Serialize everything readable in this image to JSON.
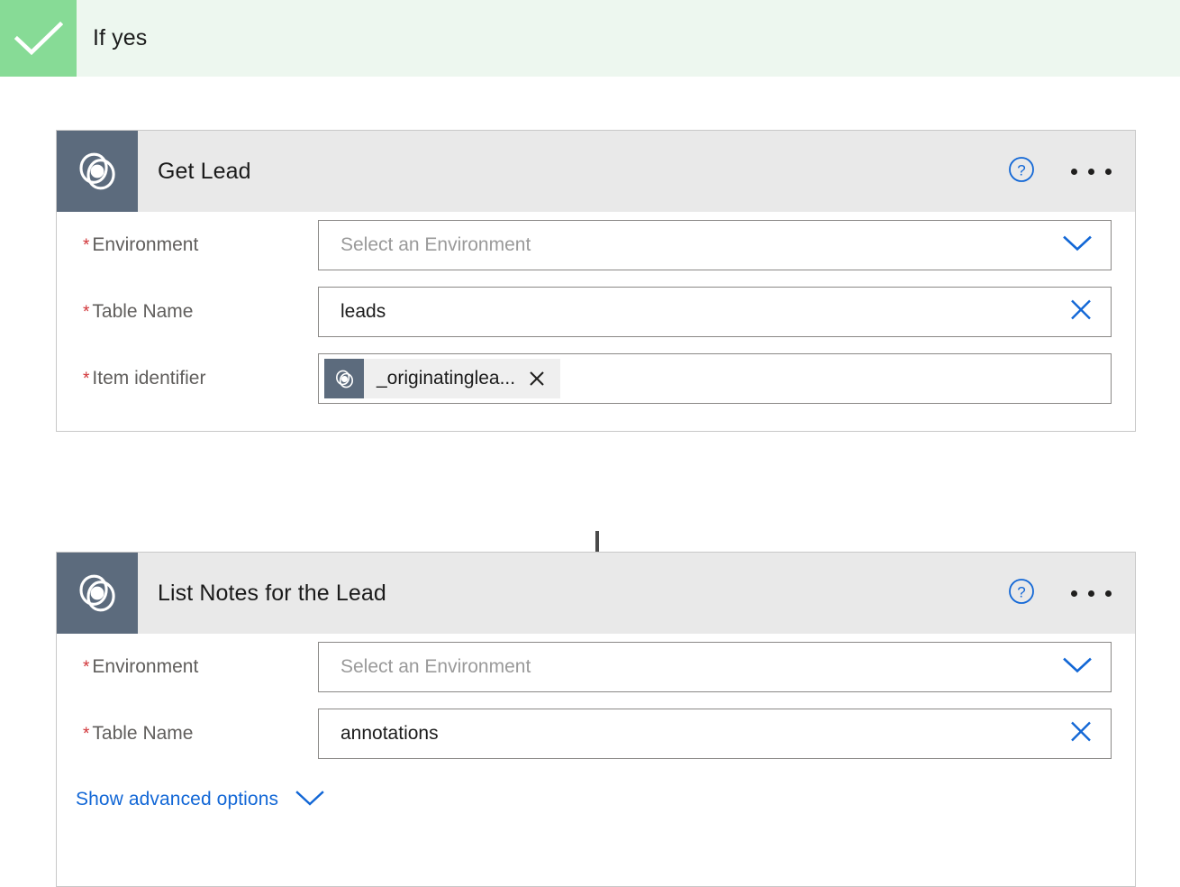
{
  "branch": {
    "title": "If yes",
    "icon": "checkmark-icon",
    "badge_color": "#87DB96",
    "band_color": "#EDF7EF"
  },
  "colors": {
    "accent_blue": "#1267d6",
    "icon_tile": "#5C6B7D",
    "header_bar": "#E9E9E9",
    "required_red": "#d13438",
    "arrow": "#4a4a4a"
  },
  "cards": [
    {
      "title": "Get Lead",
      "icon": "dataverse-icon",
      "help_icon": "help-circle-icon",
      "overflow_icon": "ellipsis-icon",
      "fields": [
        {
          "label": "Environment",
          "required": true,
          "value": "",
          "placeholder": "Select an Environment",
          "affix_icon": "chevron-down-icon",
          "type": "dropdown"
        },
        {
          "label": "Table Name",
          "required": true,
          "value": "leads",
          "placeholder": "",
          "affix_icon": "close-icon",
          "type": "combobox"
        },
        {
          "label": "Item identifier",
          "required": true,
          "type": "token",
          "token": {
            "label": "_originatinglea...",
            "icon": "dataverse-icon",
            "remove_icon": "close-icon"
          }
        }
      ],
      "advanced": null
    },
    {
      "title": "List Notes for the Lead",
      "icon": "dataverse-icon",
      "help_icon": "help-circle-icon",
      "overflow_icon": "ellipsis-icon",
      "fields": [
        {
          "label": "Environment",
          "required": true,
          "value": "",
          "placeholder": "Select an Environment",
          "affix_icon": "chevron-down-icon",
          "type": "dropdown"
        },
        {
          "label": "Table Name",
          "required": true,
          "value": "annotations",
          "placeholder": "",
          "affix_icon": "close-icon",
          "type": "combobox"
        }
      ],
      "advanced": {
        "label": "Show advanced options",
        "icon": "chevron-down-icon"
      }
    }
  ],
  "connector": {
    "icon": "arrow-down-icon"
  }
}
